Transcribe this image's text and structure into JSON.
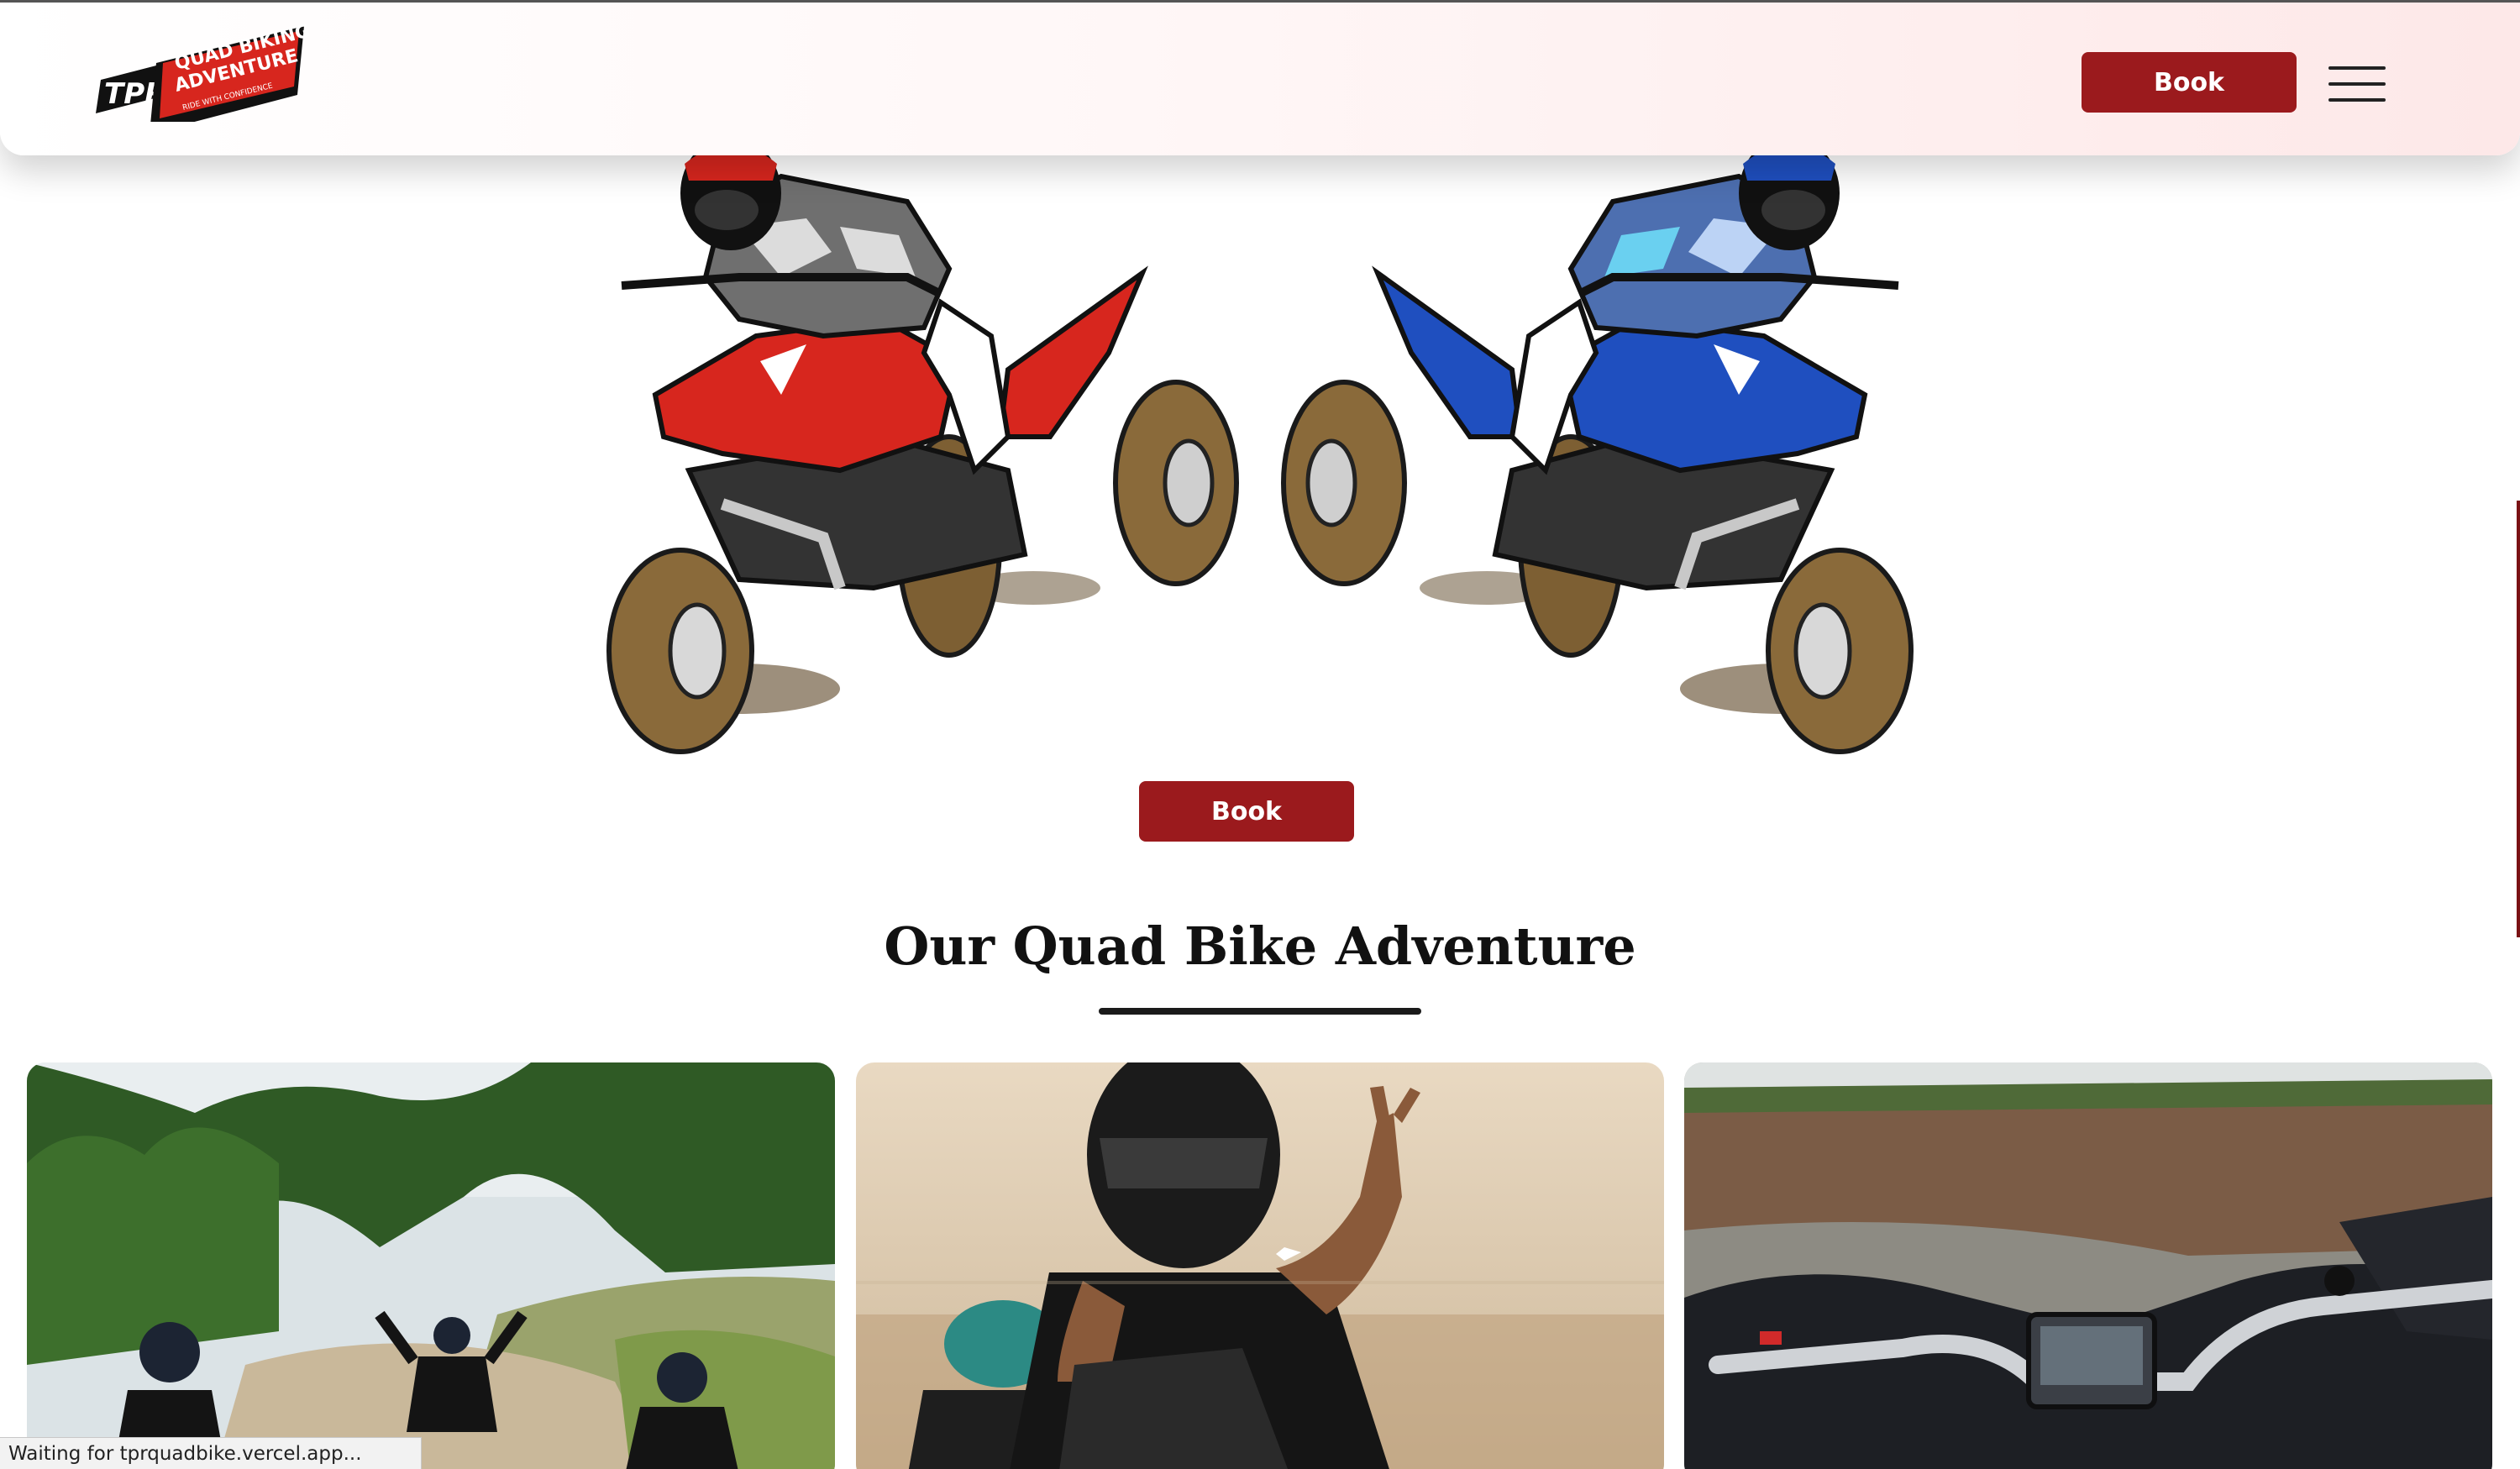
{
  "header": {
    "logo_text": {
      "mark": "TPR",
      "line1": "QUAD BIKING",
      "line2": "ADVENTURE",
      "tagline": "RIDE WITH CONFIDENCE"
    },
    "book_label": "Book",
    "menu_icon": "hamburger-menu-icon"
  },
  "hero": {
    "illustration": "two-quad-bike-riders-facing-each-other",
    "book_label": "Book",
    "colors": {
      "left_quad": "#d7261e",
      "right_quad": "#1f4fbf",
      "tires": "#8a6a3a"
    }
  },
  "gallery": {
    "title": "Our Quad Bike Adventure",
    "cards": [
      {
        "image": "riders-on-dirt-trail-photo"
      },
      {
        "image": "rider-peace-sign-photo"
      },
      {
        "image": "quad-handlebar-view-photo"
      }
    ]
  },
  "status": {
    "text": "Waiting for tprquadbike.vercel.app..."
  },
  "colors": {
    "brand_red": "#9b1a1d",
    "header_gradient_end": "#fde8e8"
  }
}
